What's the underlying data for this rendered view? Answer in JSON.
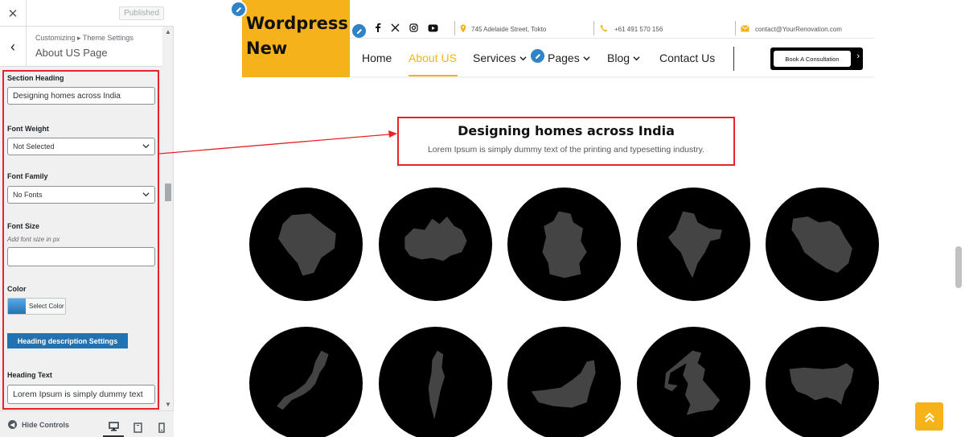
{
  "customizer": {
    "published_label": "Published",
    "crumb_small": "Customizing ▸ Theme Settings",
    "crumb_title": "About US Page",
    "section_heading_label": "Section Heading",
    "section_heading_value": "Designing homes across India",
    "font_weight_label": "Font Weight",
    "font_weight_value": "Not Selected",
    "font_family_label": "Font Family",
    "font_family_value": "No Fonts",
    "font_size_label": "Font Size",
    "font_size_hint": "Add font size in px",
    "font_size_value": "",
    "color_label": "Color",
    "select_color_label": "Select Color",
    "heading_desc_settings_label": "Heading description Settings",
    "heading_text_label": "Heading Text",
    "heading_text_value": "Lorem Ipsum is simply dummy text",
    "hide_controls_label": "Hide Controls"
  },
  "site": {
    "logo_line1": "Wordpress",
    "logo_line2": "New",
    "address": "745 Adelaide Street, Tokto",
    "phone": "+61 491 570 156",
    "email": "contact@YourRenovation.com",
    "nav": {
      "home": "Home",
      "about": "About US",
      "services": "Services",
      "pages": "Pages",
      "blog": "Blog",
      "contact": "Contact Us"
    },
    "cta_label": "Book A Consultation",
    "accent_color": "#f5b21a"
  },
  "section": {
    "title": "Designing homes across India",
    "description": "Lorem Ipsum is simply dummy text of the printing and typesetting industry."
  },
  "icons": {
    "maps_row1": [
      "brazil-map-icon",
      "canada-map-icon",
      "germany-map-icon",
      "india-map-icon",
      "iran-map-icon"
    ],
    "maps_row2": [
      "japan-map-icon",
      "israel-map-icon",
      "uae-map-icon",
      "uk-map-icon",
      "usa-map-icon"
    ]
  }
}
